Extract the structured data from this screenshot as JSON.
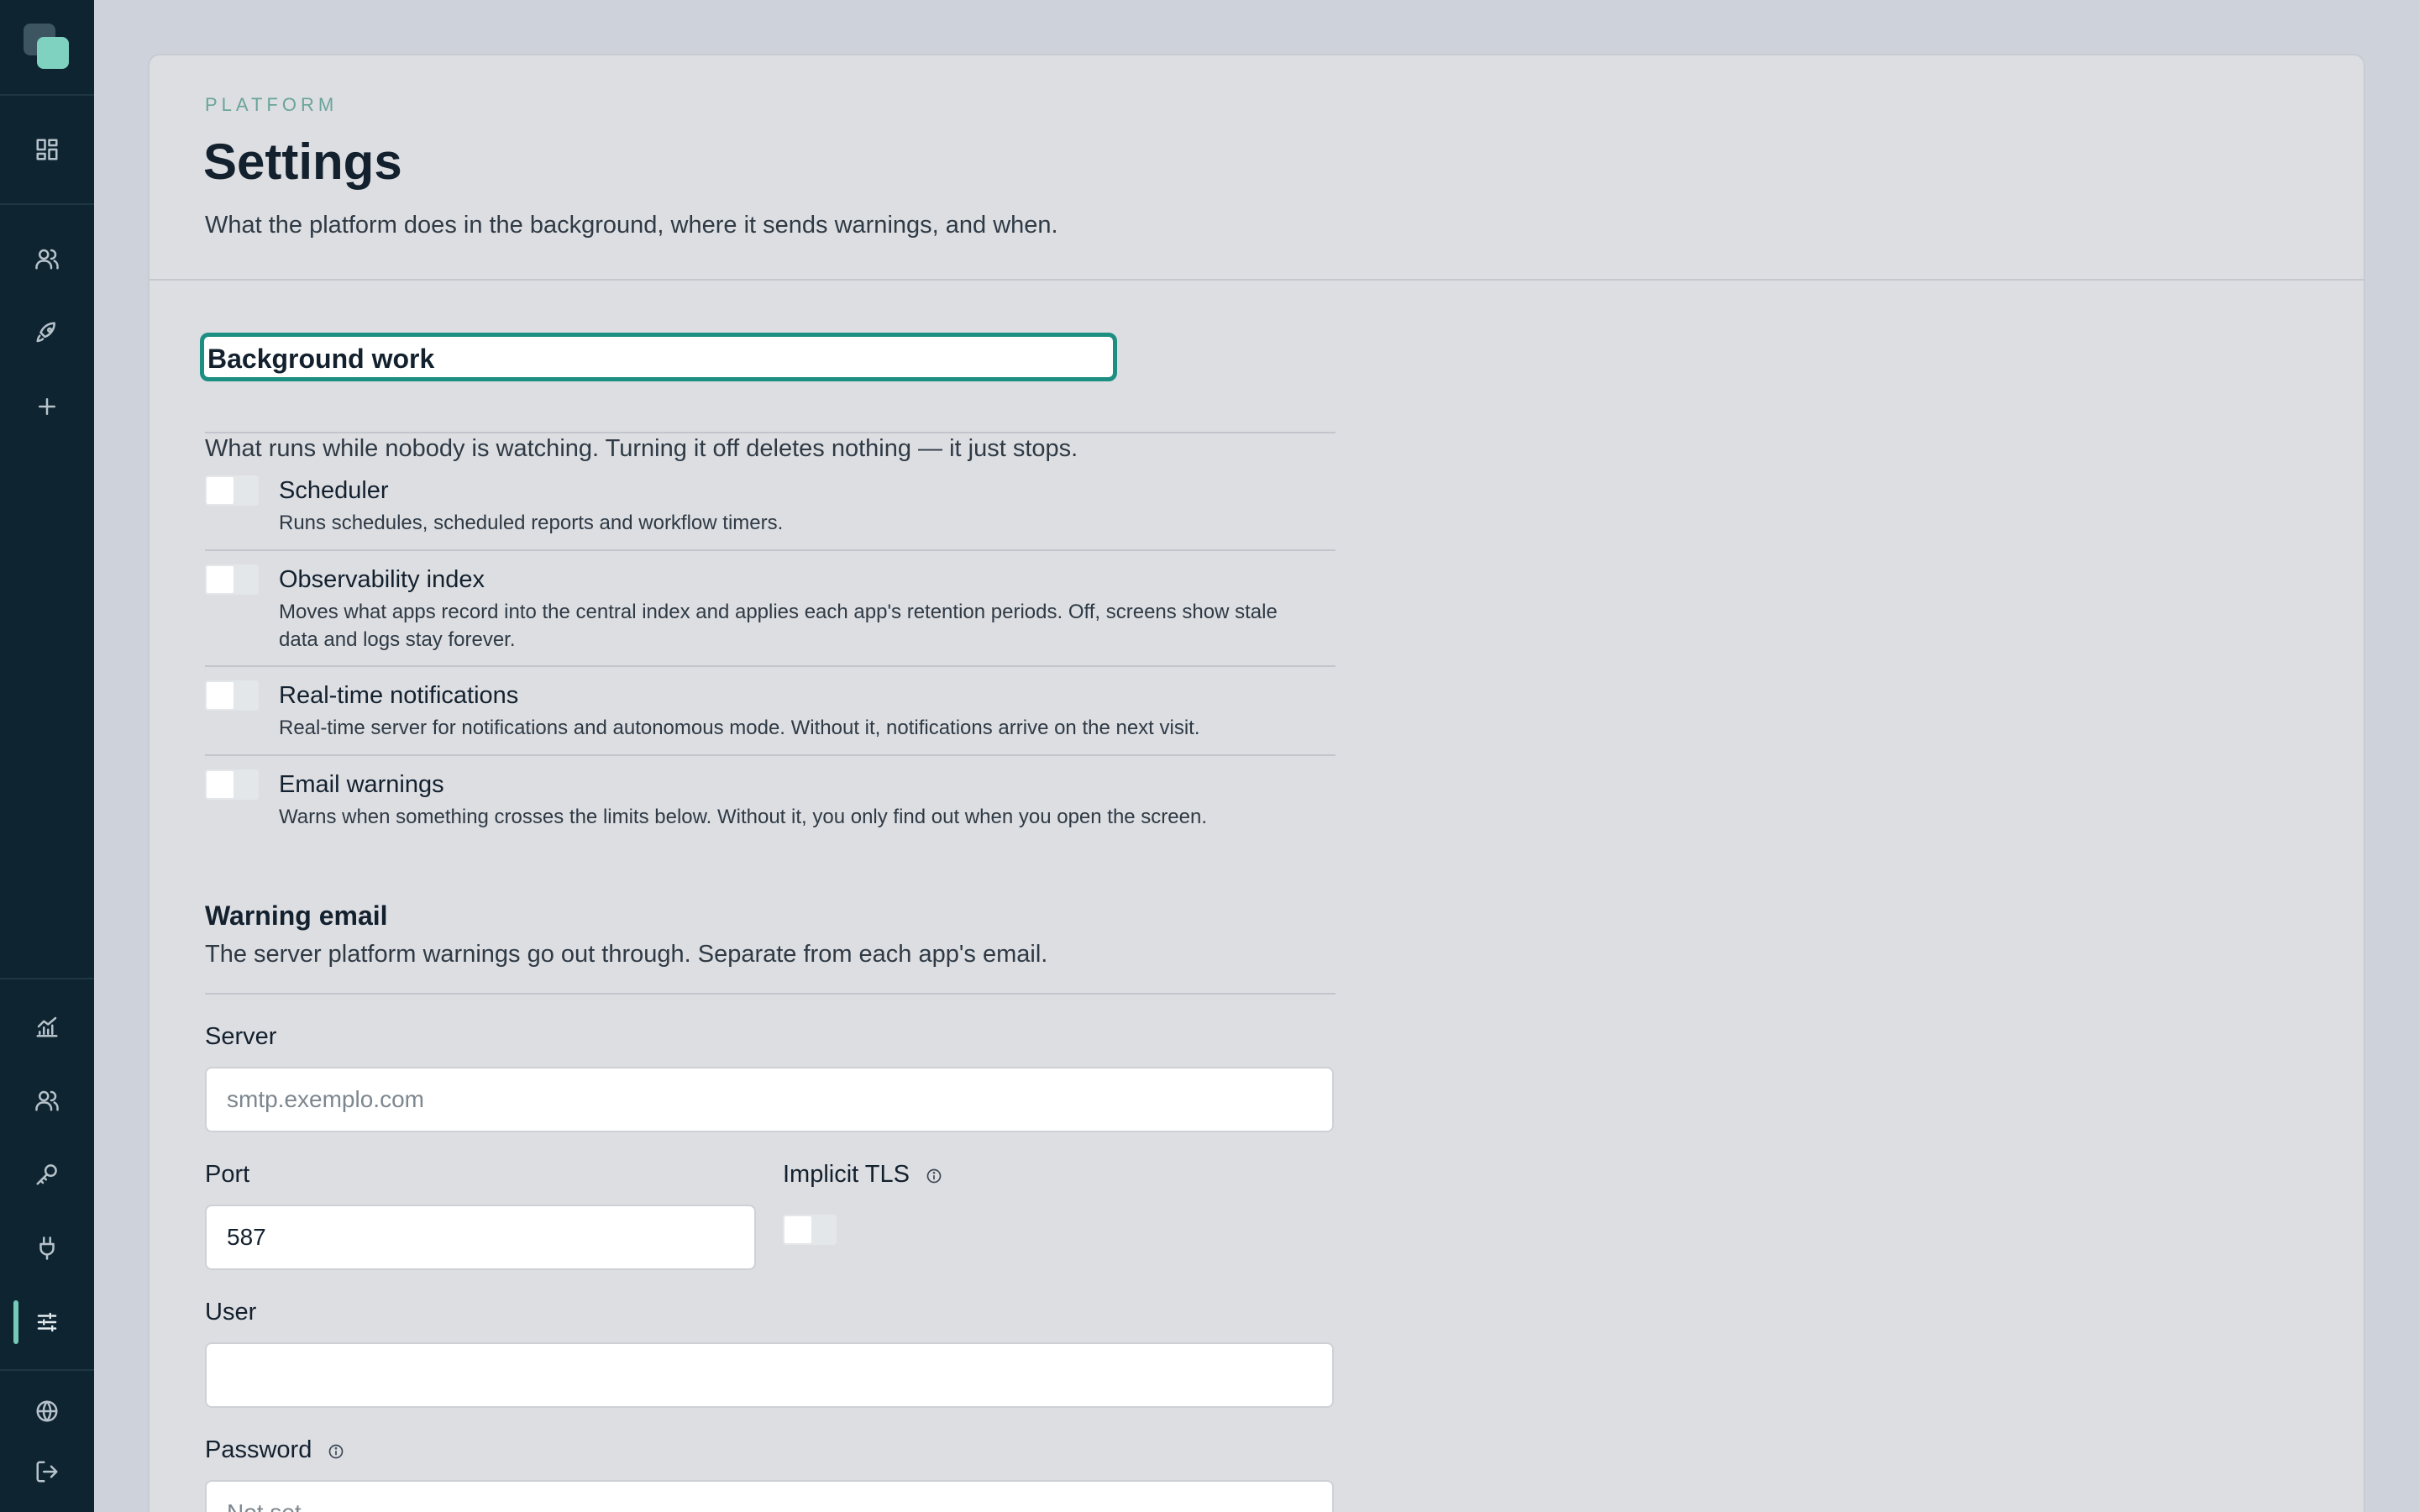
{
  "sidebar": {
    "logo": "app-logo",
    "top_items": [
      {
        "icon": "dashboard-icon"
      },
      {
        "icon": "users-icon"
      },
      {
        "icon": "rocket-icon"
      },
      {
        "icon": "plus-icon"
      }
    ],
    "bottom_items": [
      {
        "icon": "analytics-icon"
      },
      {
        "icon": "team-icon"
      },
      {
        "icon": "key-icon"
      },
      {
        "icon": "plug-icon"
      },
      {
        "icon": "sliders-icon",
        "active": true
      },
      {
        "icon": "globe-icon"
      },
      {
        "icon": "logout-icon"
      }
    ],
    "accent_color": "#74c9b8"
  },
  "header": {
    "eyebrow": "PLATFORM",
    "title": "Settings",
    "subtitle": "What the platform does in the background, where it sends warnings, and when."
  },
  "background_work": {
    "title": "Background work",
    "description": "What runs while nobody is watching. Turning it off deletes nothing — it just stops.",
    "options": [
      {
        "label": "Scheduler",
        "description": "Runs schedules, scheduled reports and workflow timers.",
        "enabled": false
      },
      {
        "label": "Observability index",
        "description": "Moves what apps record into the central index and applies each app's retention periods. Off, screens show stale data and logs stay forever.",
        "enabled": false
      },
      {
        "label": "Real-time notifications",
        "description": "Real-time server for notifications and autonomous mode. Without it, notifications arrive on the next visit.",
        "enabled": false
      },
      {
        "label": "Email warnings",
        "description": "Warns when something crosses the limits below. Without it, you only find out when you open the screen.",
        "enabled": false
      }
    ]
  },
  "warning_email": {
    "title": "Warning email",
    "description": "The server platform warnings go out through. Separate from each app's email.",
    "server": {
      "label": "Server",
      "value": "",
      "placeholder": "smtp.exemplo.com"
    },
    "port": {
      "label": "Port",
      "value": "587"
    },
    "implicit_tls": {
      "label": "Implicit TLS",
      "enabled": false
    },
    "user": {
      "label": "User",
      "value": ""
    },
    "password": {
      "label": "Password",
      "placeholder": "Not set"
    }
  },
  "colors": {
    "focus_ring": "#1d8e82",
    "eyebrow": "#6aa49a"
  }
}
